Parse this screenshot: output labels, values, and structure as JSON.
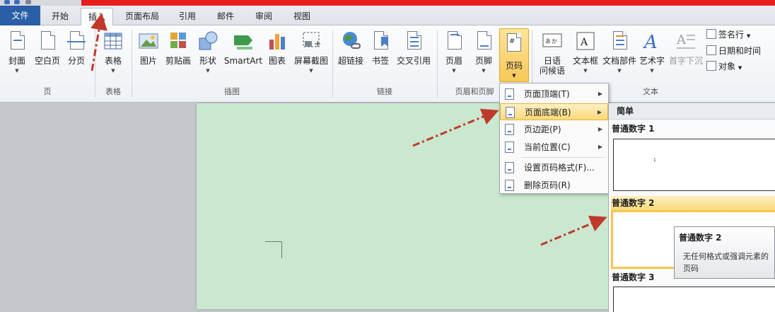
{
  "tabs": [
    {
      "label": "文件"
    },
    {
      "label": "开始"
    },
    {
      "label": "插入"
    },
    {
      "label": "页面布局"
    },
    {
      "label": "引用"
    },
    {
      "label": "邮件"
    },
    {
      "label": "审阅"
    },
    {
      "label": "视图"
    }
  ],
  "ribbon": {
    "groups": {
      "pages": "页",
      "tables": "表格",
      "illustrations": "插图",
      "links": "链接",
      "header_footer": "页眉和页脚",
      "text": "文本"
    },
    "buttons": {
      "cover": "封面",
      "blank": "空白页",
      "break": "分页",
      "table": "表格",
      "picture": "图片",
      "clipart": "剪贴画",
      "shapes": "形状",
      "smartart": "SmartArt",
      "chart": "图表",
      "screenshot": "屏幕截图",
      "hyperlink": "超链接",
      "bookmark": "书签",
      "crossref": "交叉引用",
      "header": "页眉",
      "footer": "页脚",
      "pagenum": "页码",
      "greeting_1": "日语",
      "greeting_2": "问候语",
      "textbox": "文本框",
      "quickparts": "文档部件",
      "wordart": "艺术字",
      "dropcap": "首字下沉",
      "signature": "签名行",
      "datetime": "日期和时间",
      "object": "对象"
    }
  },
  "menu": {
    "items": [
      {
        "label": "页面顶端(T)"
      },
      {
        "label": "页面底端(B)"
      },
      {
        "label": "页边距(P)"
      },
      {
        "label": "当前位置(C)"
      },
      {
        "label": "设置页码格式(F)..."
      },
      {
        "label": "删除页码(R)"
      }
    ]
  },
  "gallery": {
    "header": "简单",
    "items": [
      {
        "title": "普通数字 1",
        "sample": "1"
      },
      {
        "title": "普通数字 2"
      },
      {
        "title": "普通数字 3"
      }
    ]
  },
  "tooltip": {
    "title": "普通数字 2",
    "body": "无任何格式或强调元素的页码"
  },
  "colors": {
    "accent": "#2a5fa8",
    "highlight": "#fbd97a",
    "document": "#c9e8cf",
    "annotation_arrow": "#c0392b"
  }
}
